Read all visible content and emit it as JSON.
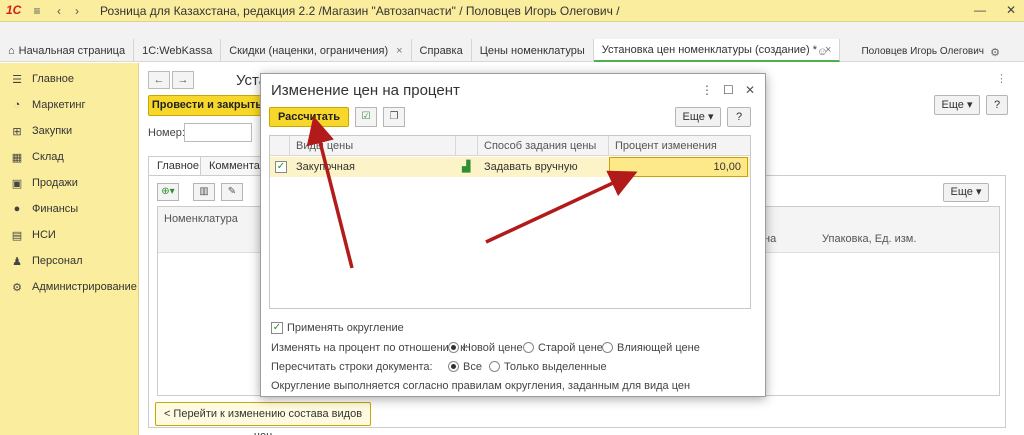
{
  "app": {
    "logo": "1С",
    "title": "Розница для Казахстана, редакция 2.2 /Магазин \"Автозапчасти\" / Половцев Игорь Олегович /",
    "user_name": "Половцев Игорь Олегович"
  },
  "tabs": [
    {
      "label": "Начальная страница"
    },
    {
      "label": "1C:WebKassa"
    },
    {
      "label": "Скидки (наценки, ограничения)"
    },
    {
      "label": "Справка"
    },
    {
      "label": "Цены номенклатуры"
    },
    {
      "label": "Установка цен номенклатуры (создание) *"
    }
  ],
  "sidebar": {
    "items": [
      {
        "label": "Главное",
        "icon": "menu-icon"
      },
      {
        "label": "Маркетинг",
        "icon": "pie-icon"
      },
      {
        "label": "Закупки",
        "icon": "cart-icon"
      },
      {
        "label": "Склад",
        "icon": "warehouse-icon"
      },
      {
        "label": "Продажи",
        "icon": "sales-icon"
      },
      {
        "label": "Финансы",
        "icon": "coins-icon"
      },
      {
        "label": "НСИ",
        "icon": "book-icon"
      },
      {
        "label": "Персонал",
        "icon": "person-icon"
      },
      {
        "label": "Администрирование",
        "icon": "gear-icon"
      }
    ]
  },
  "form": {
    "title": "Уста",
    "post_close_label": "Провести и закрыть",
    "nomer_label": "Номер:",
    "tab_main": "Главное",
    "tab_comment": "Комментар",
    "more_label": "Еще",
    "help_label": "?",
    "grid_col_nomenclature": "Номенклатура",
    "grid_col_price": "на",
    "grid_col_pack": "Упаковка, Ед. изм.",
    "back_link": "< Перейти к изменению состава видов цен"
  },
  "dialog": {
    "title": "Изменение цен на процент",
    "calc_label": "Рассчитать",
    "more_label": "Еще",
    "help_label": "?",
    "table": {
      "headers": [
        "Виды цены",
        "Способ задания цены",
        "Процент изменения"
      ],
      "rows": [
        {
          "checked": true,
          "type": "Закупочная",
          "method": "Задавать вручную",
          "percent": "10,00"
        }
      ]
    },
    "apply_rounding_label": "Применять округление",
    "change_relative_label": "Изменять на процент по отношению к:",
    "relative_options": [
      "Новой цене",
      "Старой цене",
      "Влияющей цене"
    ],
    "recalc_rows_label": "Пересчитать строки документа:",
    "recalc_options": [
      "Все",
      "Только выделенные"
    ],
    "rounding_note": "Округление выполняется согласно правилам округления, заданным для вида цен"
  },
  "colors": {
    "accent_yellow": "#f7d82a",
    "header_yellow": "#fbed9e",
    "arrow_red": "#b31b1b"
  }
}
